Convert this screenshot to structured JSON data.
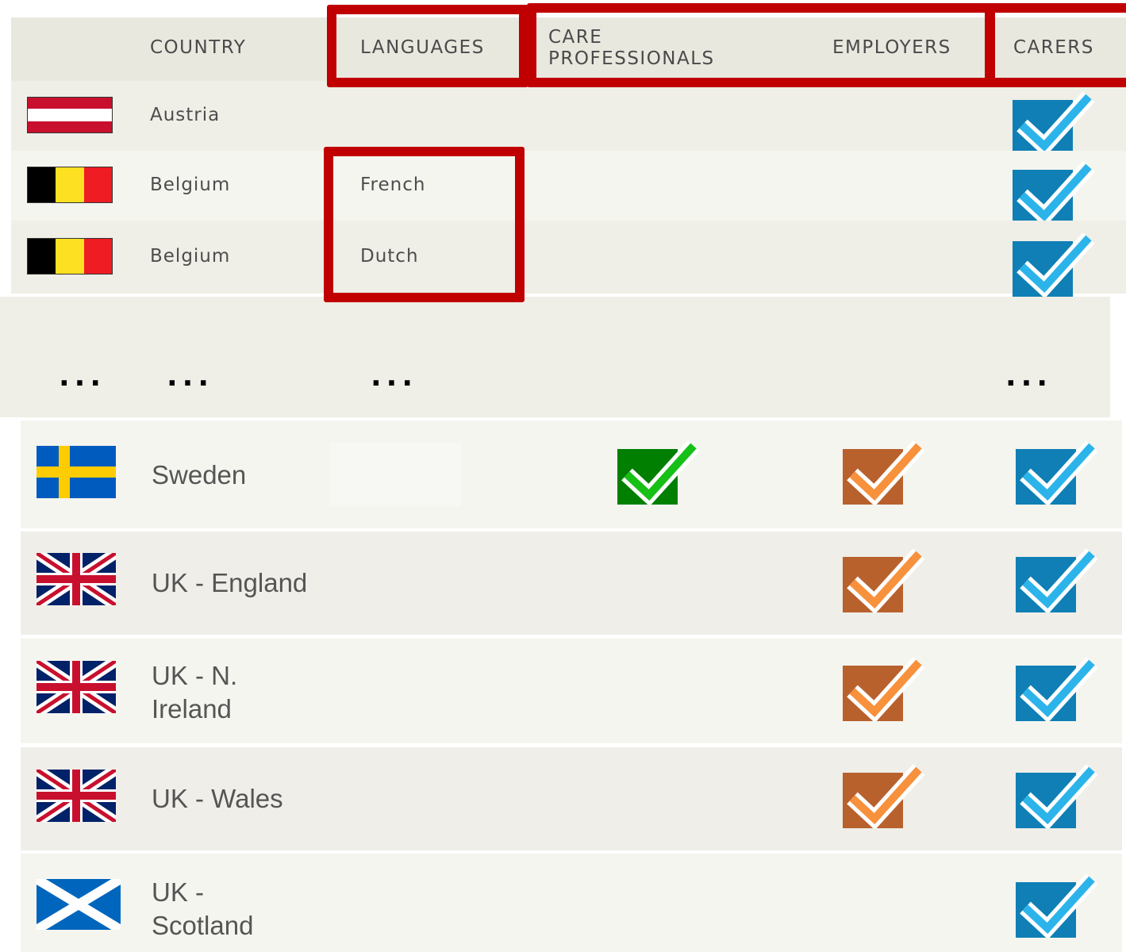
{
  "header": {
    "country": "COUNTRY",
    "languages": "LANGUAGES",
    "care_professionals_line1": "CARE",
    "care_professionals_line2": "PROFESSIONALS",
    "employers": "EMPLOYERS",
    "carers": "CARERS"
  },
  "top_rows": [
    {
      "country": "Austria",
      "language": "",
      "flag": "austria-flag",
      "carers": true
    },
    {
      "country": "Belgium",
      "language": "French",
      "flag": "belgium-flag",
      "carers": true
    },
    {
      "country": "Belgium",
      "language": "Dutch",
      "flag": "belgium-flag",
      "carers": true
    }
  ],
  "ellipsis": "...",
  "bottom_rows": [
    {
      "country": "Sweden",
      "flag": "sweden-flag",
      "care_professionals": true,
      "employers": true,
      "carers": true
    },
    {
      "country": "UK - England",
      "flag": "uk-flag",
      "care_professionals": false,
      "employers": true,
      "carers": true
    },
    {
      "country_line1": "UK - N.",
      "country_line2": "Ireland",
      "flag": "uk-flag",
      "care_professionals": false,
      "employers": true,
      "carers": true
    },
    {
      "country": "UK - Wales",
      "flag": "uk-flag",
      "care_professionals": false,
      "employers": true,
      "carers": true
    },
    {
      "country_line1": "UK -",
      "country_line2": "Scotland",
      "flag": "scotland-flag",
      "care_professionals": false,
      "employers": false,
      "carers": true
    }
  ],
  "colors": {
    "highlight_box": "#c00000",
    "check_green": "#008a00",
    "check_orange": "#b8612d",
    "check_blue": "#0f7fb5"
  }
}
